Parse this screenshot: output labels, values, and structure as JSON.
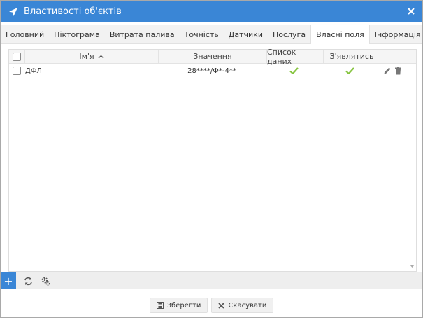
{
  "window": {
    "title": "Властивості об'єктів",
    "accent": "#3a86d6"
  },
  "tabs": [
    {
      "label": "Головний"
    },
    {
      "label": "Піктограма"
    },
    {
      "label": "Витрата палива"
    },
    {
      "label": "Точність"
    },
    {
      "label": "Датчики"
    },
    {
      "label": "Послуга"
    },
    {
      "label": "Власні поля",
      "active": true
    },
    {
      "label": "Інформація"
    }
  ],
  "grid": {
    "columns": {
      "name": "Ім'я",
      "value": "Значення",
      "list": "Список даних",
      "visible": "З'являтись"
    },
    "sort": {
      "column": "name",
      "direction": "asc"
    },
    "rows": [
      {
        "name": "ДФЛ",
        "value": "28****/Ф*-4**",
        "in_list": true,
        "visible": true
      }
    ]
  },
  "toolbar": {
    "add_label": "+"
  },
  "footer": {
    "save_label": "Зберегти",
    "cancel_label": "Скасувати"
  }
}
